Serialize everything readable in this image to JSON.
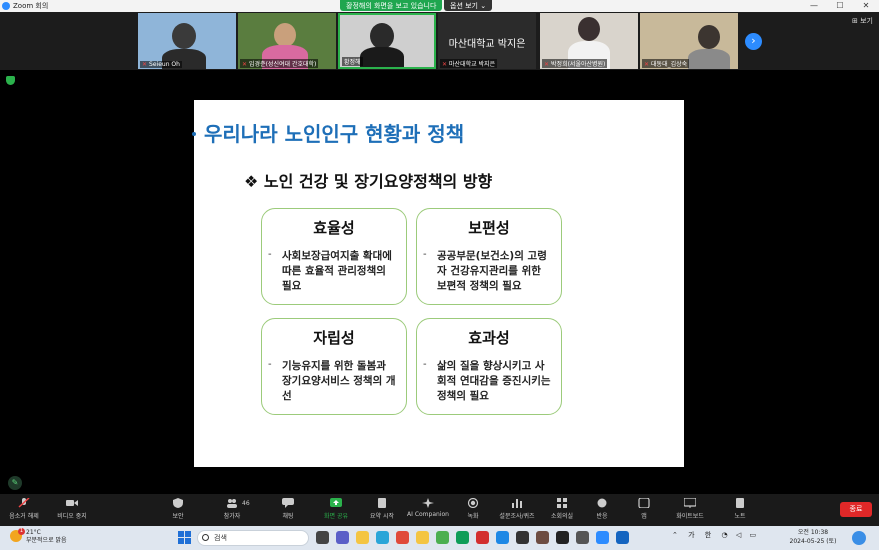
{
  "window": {
    "title": "Zoom 회의",
    "share_banner": "황정해의 화면을 보고 있습니다",
    "view_options": "옵션 보기 ⌄",
    "controls": {
      "minimize": "—",
      "maximize": "☐",
      "close": "✕"
    }
  },
  "gallery": {
    "view_label": "⊞ 보기",
    "next_icon": "›",
    "participants": [
      {
        "name": "Seieun Oh",
        "muted": true
      },
      {
        "name": "임경춘(성신여대 간호대학)",
        "muted": true
      },
      {
        "name": "황정해",
        "muted": false
      },
      {
        "name": "마산대학교 박지은",
        "muted": true,
        "display_name": "마산대학교 박지은"
      },
      {
        "name": "박정희(서울아산병원)",
        "muted": true
      },
      {
        "name": "대동대_김상숙",
        "muted": true
      }
    ]
  },
  "slide": {
    "title": "우리나라 노인인구 현황과 정책",
    "subtitle": "❖ 노인 건강 및 장기요양정책의 방향",
    "boxes": [
      {
        "heading": "효율성",
        "dash": "-",
        "text": "사회보장급여지출 확대에 따른 효율적 관리정책의 필요"
      },
      {
        "heading": "보편성",
        "dash": "-",
        "text": "공공부문(보건소)의 고령자 건강유지관리를 위한 보편적 정책의 필요"
      },
      {
        "heading": "자립성",
        "dash": "-",
        "text": "기능유지를 위한 돌봄과 장기요양서비스 정책의 개선"
      },
      {
        "heading": "효과성",
        "dash": "-",
        "text": "삶의 질을 향상시키고 사회적 연대감을 증진시키는 정책의 필요"
      }
    ]
  },
  "toolbar": {
    "unmute": "음소거 해제",
    "video": "비디오 중지",
    "security": "보안",
    "participants": "참가자",
    "participants_count": "46",
    "chat": "채팅",
    "share": "화면 공유",
    "summary": "요약 시작",
    "ai": "AI Companion",
    "record": "녹화",
    "polls": "설문조사/퀴즈",
    "breakout": "소회의실",
    "reactions": "반응",
    "apps": "앱",
    "whiteboard": "화이트보드",
    "notes": "노트",
    "end": "종료"
  },
  "taskbar": {
    "weather_temp": "21°C",
    "weather_desc": "부분적으로 맑음",
    "weather_badge": "1",
    "search_placeholder": "검색",
    "ime": "가",
    "ime2": "한",
    "time": "오전 10:38",
    "date": "2024-05-25 (토)"
  }
}
